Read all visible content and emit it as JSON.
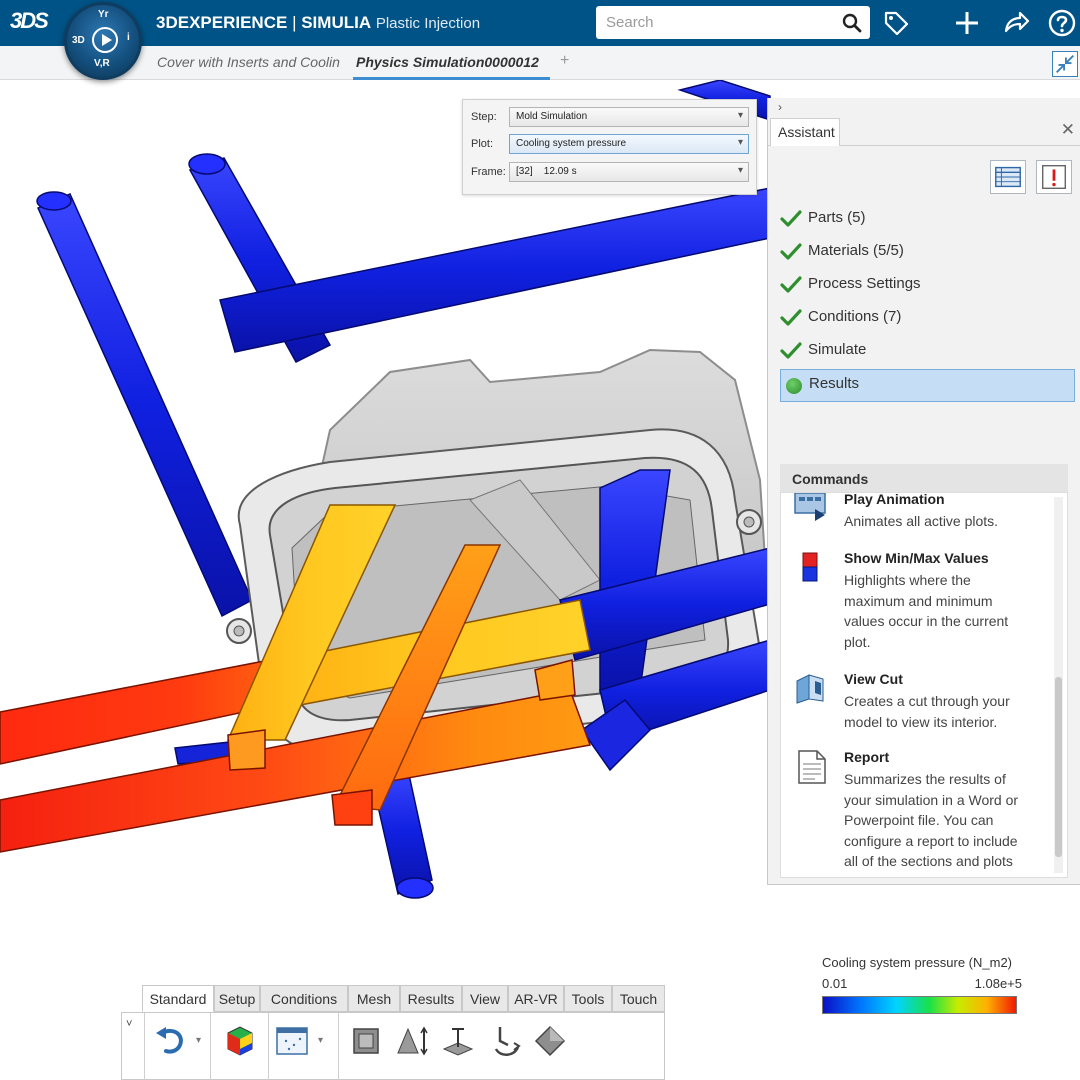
{
  "app": {
    "brand_prefix": "3DEXPERIENCE",
    "brand_separator": "|",
    "brand_product": "SIMULIA",
    "brand_app": "Plastic Injection",
    "logo_text": "3DS"
  },
  "compass": {
    "north": "Yr",
    "west": "3D",
    "east": "i",
    "south": "V,R"
  },
  "search": {
    "placeholder": "Search"
  },
  "topbar_icons": [
    "tag-icon",
    "add-icon",
    "share-icon",
    "help-icon"
  ],
  "tabs": [
    {
      "label": "Cover with Inserts and Coolin",
      "active": false
    },
    {
      "label": "Physics Simulation0000012",
      "active": true
    }
  ],
  "add_tab_label": "+",
  "plot_panel": {
    "step_label": "Step:",
    "step_value": "Mold Simulation",
    "plot_label": "Plot:",
    "plot_value": "Cooling system pressure",
    "frame_label": "Frame:",
    "frame_value": "[32]    12.09 s"
  },
  "assistant": {
    "collapse_glyph": "›",
    "tab_label": "Assistant",
    "close_glyph": "✕",
    "checklist": [
      {
        "label": "Parts (5)",
        "status": "done"
      },
      {
        "label": "Materials (5/5)",
        "status": "done"
      },
      {
        "label": "Process Settings",
        "status": "done"
      },
      {
        "label": "Conditions (7)",
        "status": "done"
      },
      {
        "label": "Simulate",
        "status": "done"
      },
      {
        "label": "Results",
        "status": "active"
      }
    ],
    "commands_header": "Commands",
    "commands": [
      {
        "title": "Play Animation",
        "desc": "Animates all active plots.",
        "icon": "play-animation-icon"
      },
      {
        "title": "Show Min/Max Values",
        "desc": "Highlights where the maximum and minimum values occur in the current plot.",
        "icon": "min-max-icon"
      },
      {
        "title": "View Cut",
        "desc": "Creates a cut through your model to view its interior.",
        "icon": "view-cut-icon"
      },
      {
        "title": "Report",
        "desc": "Summarizes the results of your simulation in a Word or Powerpoint file. You can configure a report to include all of the sections and plots",
        "icon": "report-icon"
      }
    ]
  },
  "legend": {
    "title": "Cooling system pressure (N_m2)",
    "min": "0.01",
    "max": "1.08e+5",
    "colors": [
      "#0a10c8",
      "#0078ff",
      "#00d4ff",
      "#19e04a",
      "#c8ec00",
      "#ffb000",
      "#f01a00"
    ]
  },
  "action_bar": {
    "tabs": [
      "Standard",
      "Setup",
      "Conditions",
      "Mesh",
      "Results",
      "View",
      "AR-VR",
      "Tools",
      "Touch"
    ],
    "active_tab": "Standard",
    "collapse_glyph": "˅",
    "icons": [
      "undo-icon",
      "simulation-results-icon",
      "mesh-display-icon",
      "box-icon",
      "dimension-icon",
      "measure-icon",
      "anchor-icon",
      "shape-icon"
    ]
  },
  "colors": {
    "topbar": "#005386",
    "accent": "#3d8ed0",
    "check_green": "#2f8f2f",
    "results_highlight": "#c6def5"
  }
}
